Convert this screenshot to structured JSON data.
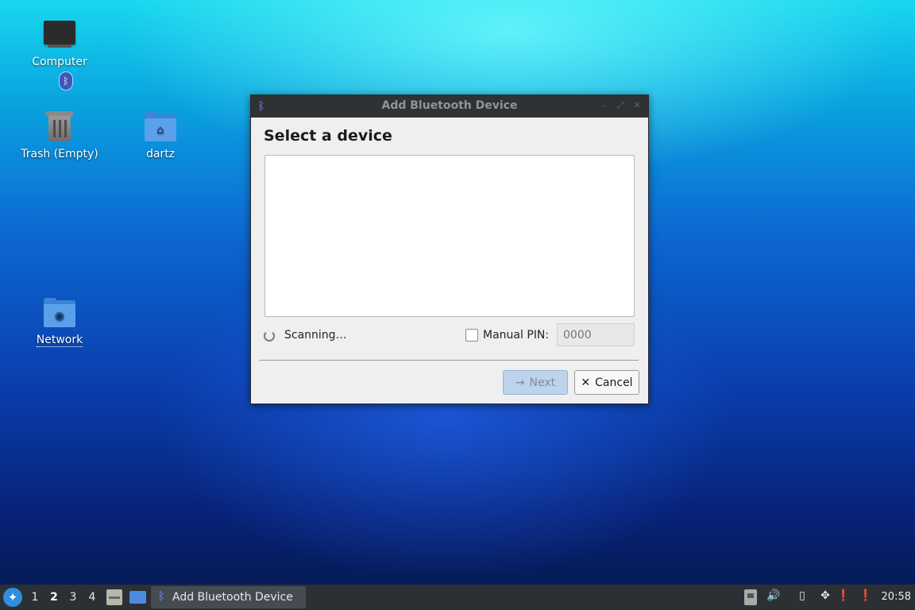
{
  "desktop": {
    "icons": [
      {
        "label": "Computer"
      },
      {
        "label": "Trash (Empty)"
      },
      {
        "label": "dartz"
      },
      {
        "label": "Network"
      }
    ]
  },
  "dialog": {
    "title": "Add Bluetooth Device",
    "heading": "Select a device",
    "status": "Scanning…",
    "manual_pin_label": "Manual PIN:",
    "manual_pin_checked": false,
    "pin_placeholder": "0000",
    "next_label": "Next",
    "cancel_label": "Cancel"
  },
  "taskbar": {
    "workspaces": [
      "1",
      "2",
      "3",
      "4"
    ],
    "active_workspace": "2",
    "task_label": "Add Bluetooth Device",
    "clock": "20:58"
  }
}
